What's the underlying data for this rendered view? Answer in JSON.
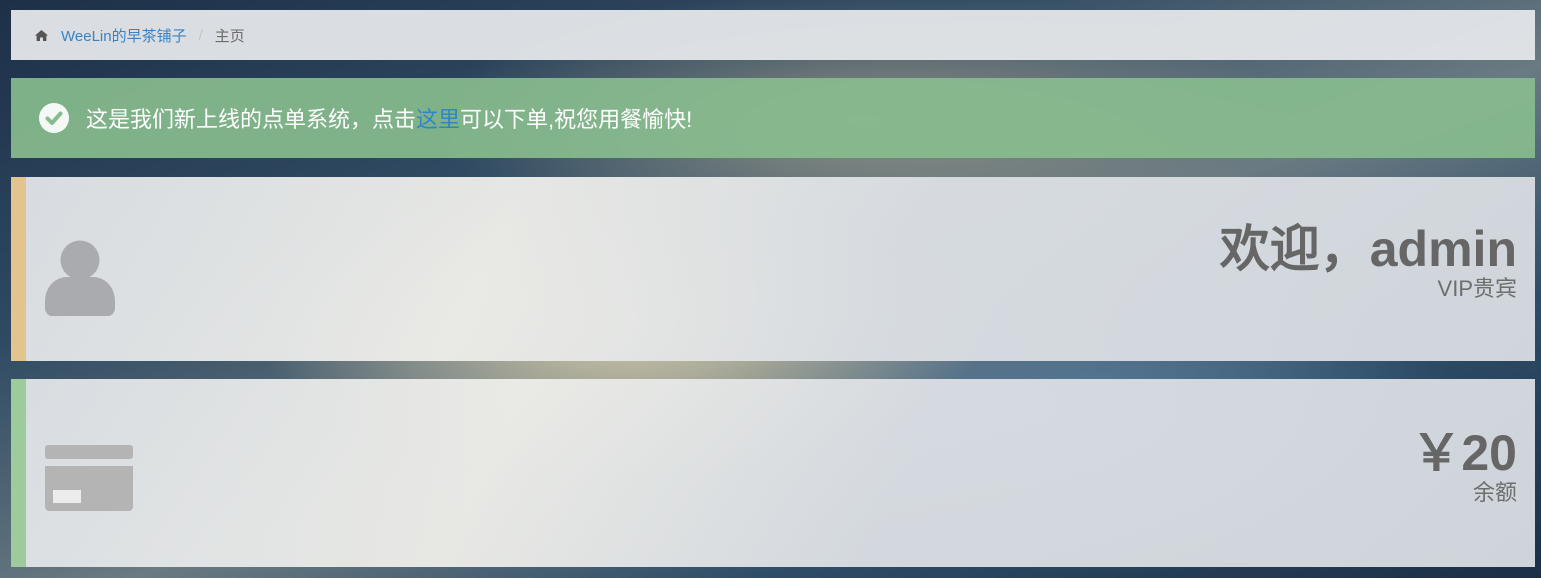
{
  "breadcrumb": {
    "home_icon": "home-icon",
    "site_name": "WeeLin的早茶铺子",
    "separator": "/",
    "current": "主页"
  },
  "alert": {
    "icon": "check-circle-icon",
    "text_before": "这是我们新上线的点单系统，点击",
    "link_text": "这里",
    "text_after": "可以下单,祝您用餐愉快!",
    "color": "#88bc8e"
  },
  "user_panel": {
    "icon": "user-icon",
    "number": "欢迎，admin",
    "desc": "VIP贵宾",
    "accent": "#e3c38e"
  },
  "balance_panel": {
    "icon": "credit-card-icon",
    "number": "￥20",
    "desc": "余额",
    "accent": "#9dcb9c"
  }
}
